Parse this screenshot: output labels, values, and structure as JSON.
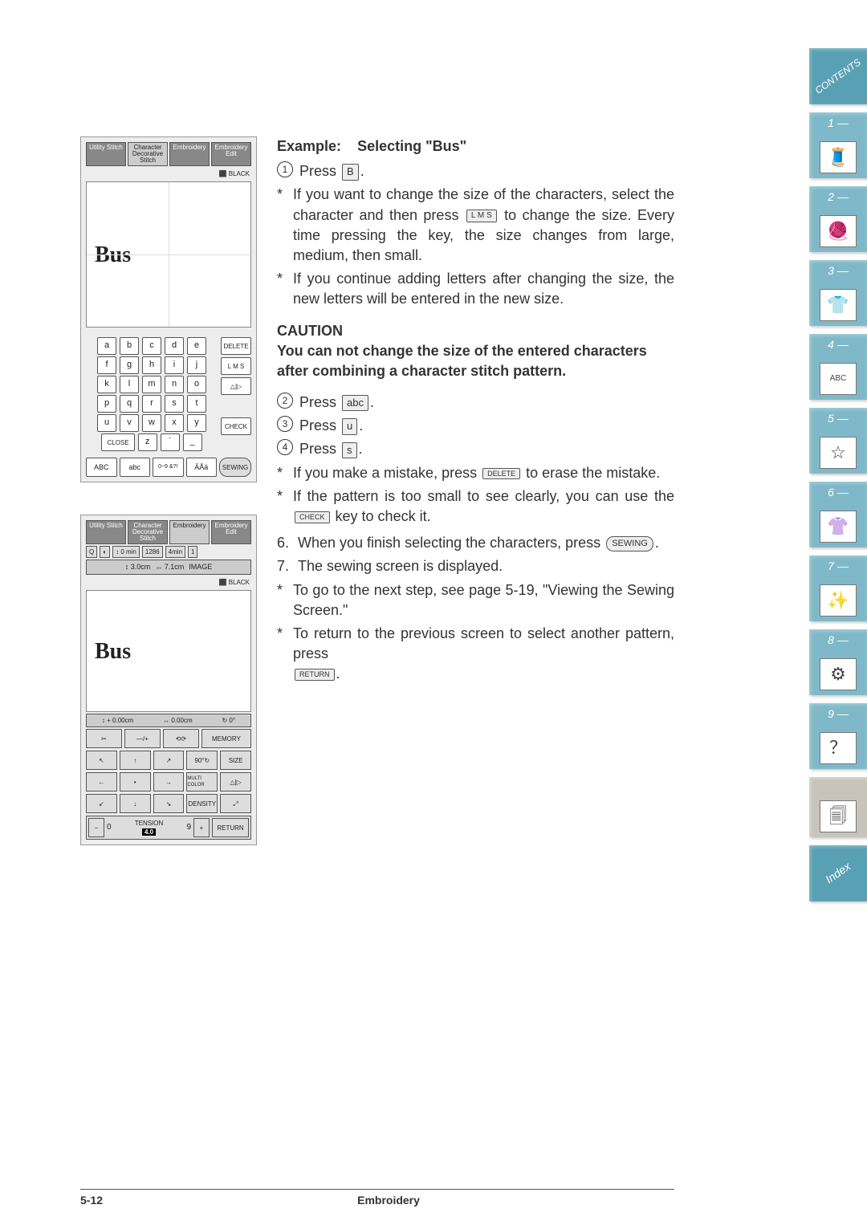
{
  "example_heading_prefix": "Example:",
  "example_heading_title": "Selecting \"Bus\"",
  "steps": {
    "press_label": "Press",
    "key_B": "B",
    "star1": "If you want to change the size of the characters, select the character and then press",
    "key_LMS": "L M S",
    "star1_tail": "to change the size. Every time pressing the key, the size changes from large, medium, then small.",
    "star2": "If you continue adding letters after changing the size, the new letters will be entered in the new size.",
    "caution_label": "CAUTION",
    "caution_text": "You can not change the size of the entered characters after combining a character stitch pattern.",
    "key_abc": "abc",
    "key_u": "u",
    "key_s": "s",
    "mistake_text": "If you make a mistake, press",
    "key_delete": "DELETE",
    "mistake_tail": "to erase the mistake.",
    "small_text": "If the pattern is too small to see clearly, you can use the",
    "key_check": "CHECK",
    "small_tail": "key to check it.",
    "step6": "When you finish selecting the characters, press",
    "key_sewing": "SEWING",
    "step6_tail": ".",
    "step7": "The sewing screen is displayed.",
    "star_goto": "To go to the next step, see page 5-19, \"Viewing the Sewing Screen.\"",
    "star_return": "To return to the previous screen to select another pattern, press",
    "key_return": "RETURN",
    "star_return_tail": "."
  },
  "screenshot1": {
    "tabs": [
      "Utility Stitch",
      "Character Decorative Stitch",
      "Embroidery",
      "Embroidery Edit"
    ],
    "accent_label": "BLACK",
    "preview_text": "Bus",
    "rows": [
      [
        "a",
        "b",
        "c",
        "d",
        "e"
      ],
      [
        "f",
        "g",
        "h",
        "i",
        "j"
      ],
      [
        "k",
        "l",
        "m",
        "n",
        "o"
      ],
      [
        "p",
        "q",
        "r",
        "s",
        "t"
      ],
      [
        "u",
        "v",
        "w",
        "x",
        "y"
      ]
    ],
    "last_row": [
      "CLOSE",
      "z",
      "`",
      "_"
    ],
    "side_keys": [
      "DELETE",
      "L M S",
      "△|▷",
      "CHECK"
    ],
    "bottom": [
      "ABC",
      "abc",
      "0~9 &?!",
      "ÄÅä"
    ],
    "sewing": "SEWING"
  },
  "screenshot2": {
    "tabs": [
      "Utility Stitch",
      "Character Decorative Stitch",
      "Embroidery",
      "Embroidery Edit"
    ],
    "status": {
      "count": "1286",
      "time": "4min",
      "other": "0 min"
    },
    "dims": {
      "h": "3.0cm",
      "w": "7.1cm",
      "btn": "IMAGE"
    },
    "accent_label": "BLACK",
    "preview_text": "Bus",
    "pos": {
      "x": "0.00cm",
      "y": "0.00cm",
      "rot": "0°"
    },
    "buttons_row1": [
      "✂",
      "―/+",
      "⟲⟳",
      "MEMORY"
    ],
    "arrows": [
      "↖",
      "↑",
      "↗",
      "90°↻",
      "SIZE",
      "←",
      "•",
      "→",
      "MULTI COLOR",
      "△|▷",
      "↙",
      "↓",
      "↘",
      "DENSITY",
      "⤢"
    ],
    "tension": {
      "label": "TENSION",
      "minus": "−",
      "zero": "0",
      "val": "4.0",
      "nine": "9",
      "plus": "+",
      "return": "RETURN"
    }
  },
  "side_tabs": {
    "contents": "CONTENTS",
    "nums": [
      "1 —",
      "2 —",
      "3 —",
      "4 —",
      "5 —",
      "6 —",
      "7 —",
      "8 —",
      "9 —"
    ],
    "abc_label": "ABC",
    "index": "Index"
  },
  "footer": {
    "page": "5-12",
    "section": "Embroidery"
  }
}
